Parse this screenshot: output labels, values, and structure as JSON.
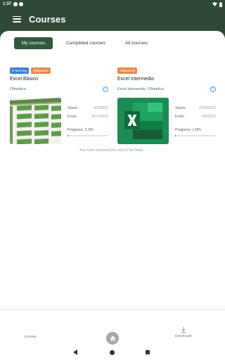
{
  "status_bar": {
    "time": "1:37"
  },
  "app_bar": {
    "title": "Courses"
  },
  "tabs": [
    {
      "label": "My courses",
      "active": true
    },
    {
      "label": "Completed courses",
      "active": false
    },
    {
      "label": "All courses",
      "active": false
    }
  ],
  "courses": [
    {
      "badges": [
        "E-learning",
        "Obligatorio"
      ],
      "title": "Excel Básico",
      "subtitle": "Ofimática",
      "starts_label": "Starts:",
      "starts": "4/7/2022",
      "ends_label": "Ends:",
      "ends": "31/7/2022",
      "progress_label": "Progress: 2.3%",
      "progress": 0.023
    },
    {
      "badges": [
        "Obligatorio"
      ],
      "title": "Excel Intermedio",
      "subtitle": "Excel Intermedio, Ofimática",
      "starts_label": "Starts:",
      "starts": "27/6/2022",
      "ends_label": "Ends:",
      "ends": "1/8/2022",
      "progress_label": "Progress: 1.8%",
      "progress": 0.018
    }
  ],
  "feed_end": "You have reached the end of the feed...",
  "bottom_nav": {
    "courses_label": "Courses",
    "downloads_label": "Downloads"
  },
  "colors": {
    "header": "#2e4a37",
    "active_tab": "#2e5a3e",
    "badge_blue": "#3b7ed8",
    "badge_orange": "#e58a4a",
    "excel_green": "#107c41"
  }
}
